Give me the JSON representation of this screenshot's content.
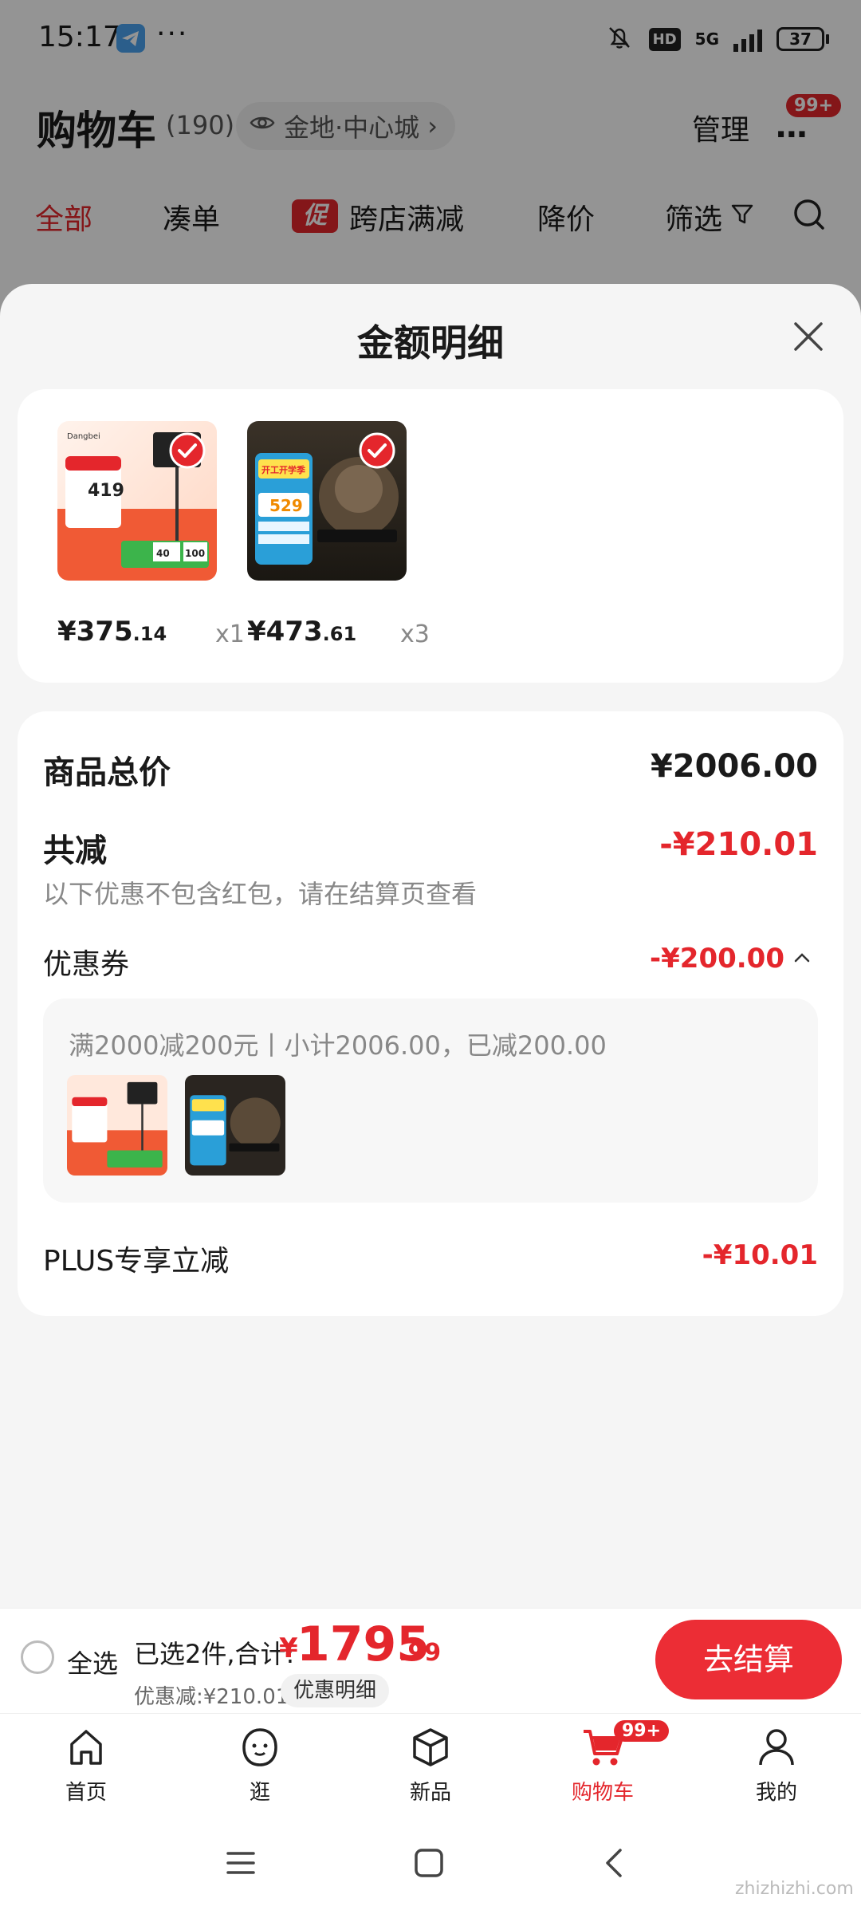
{
  "status_bar": {
    "time": "15:17",
    "dots": "···",
    "hd": "HD",
    "network": "5G",
    "battery": "37"
  },
  "header": {
    "title": "购物车",
    "count": "(190)",
    "location": "金地·中心城",
    "location_chevron": "›",
    "manage_label": "管理",
    "more_icon": "···",
    "more_badge": "99+"
  },
  "filters": {
    "all": "全部",
    "bundle": "凑单",
    "promo_tag": "促",
    "cross_store": "跨店满减",
    "price_drop": "降价",
    "filter": "筛选"
  },
  "sheet": {
    "title": "金额明细",
    "products": [
      {
        "price_symbol": "¥",
        "price_int": "375",
        "price_dec": ".14",
        "qty": "x1"
      },
      {
        "price_symbol": "¥",
        "price_int": "473",
        "price_dec": ".61",
        "qty": "x3"
      }
    ],
    "product_thumb_text": {
      "p1_brand": "Dangbei",
      "p1_price": "419",
      "p1_tags": [
        "40",
        "100"
      ],
      "p2_price": "529",
      "p2_banner": "开工开学季"
    },
    "summary": {
      "total_label": "商品总价",
      "total_value": "¥2006.00",
      "reduce_label": "共减",
      "reduce_value": "-¥210.01",
      "note": "以下优惠不包含红包，请在结算页查看",
      "coupon_label": "优惠券",
      "coupon_value": "-¥200.00",
      "coupon_rule": "满2000减200元丨小计2006.00，已减200.00",
      "plus_label": "PLUS专享立减",
      "plus_value": "-¥10.01"
    }
  },
  "checkout": {
    "select_all": "全选",
    "selected_summary": "已选2件,合计:",
    "total_symbol": "¥",
    "total_int": "1795",
    "total_dec": ".99",
    "discount": "优惠减:¥210.01",
    "detail_label": "优惠明细",
    "checkout_label": "去结算"
  },
  "bottom_nav": {
    "items": [
      {
        "label": "首页"
      },
      {
        "label": "逛"
      },
      {
        "label": "新品"
      },
      {
        "label": "购物车",
        "badge": "99+"
      },
      {
        "label": "我的"
      }
    ]
  },
  "colors": {
    "accent_red": "#e4262c",
    "checkout_red": "#ec2d35"
  },
  "watermark": "zhizhizhi.com"
}
